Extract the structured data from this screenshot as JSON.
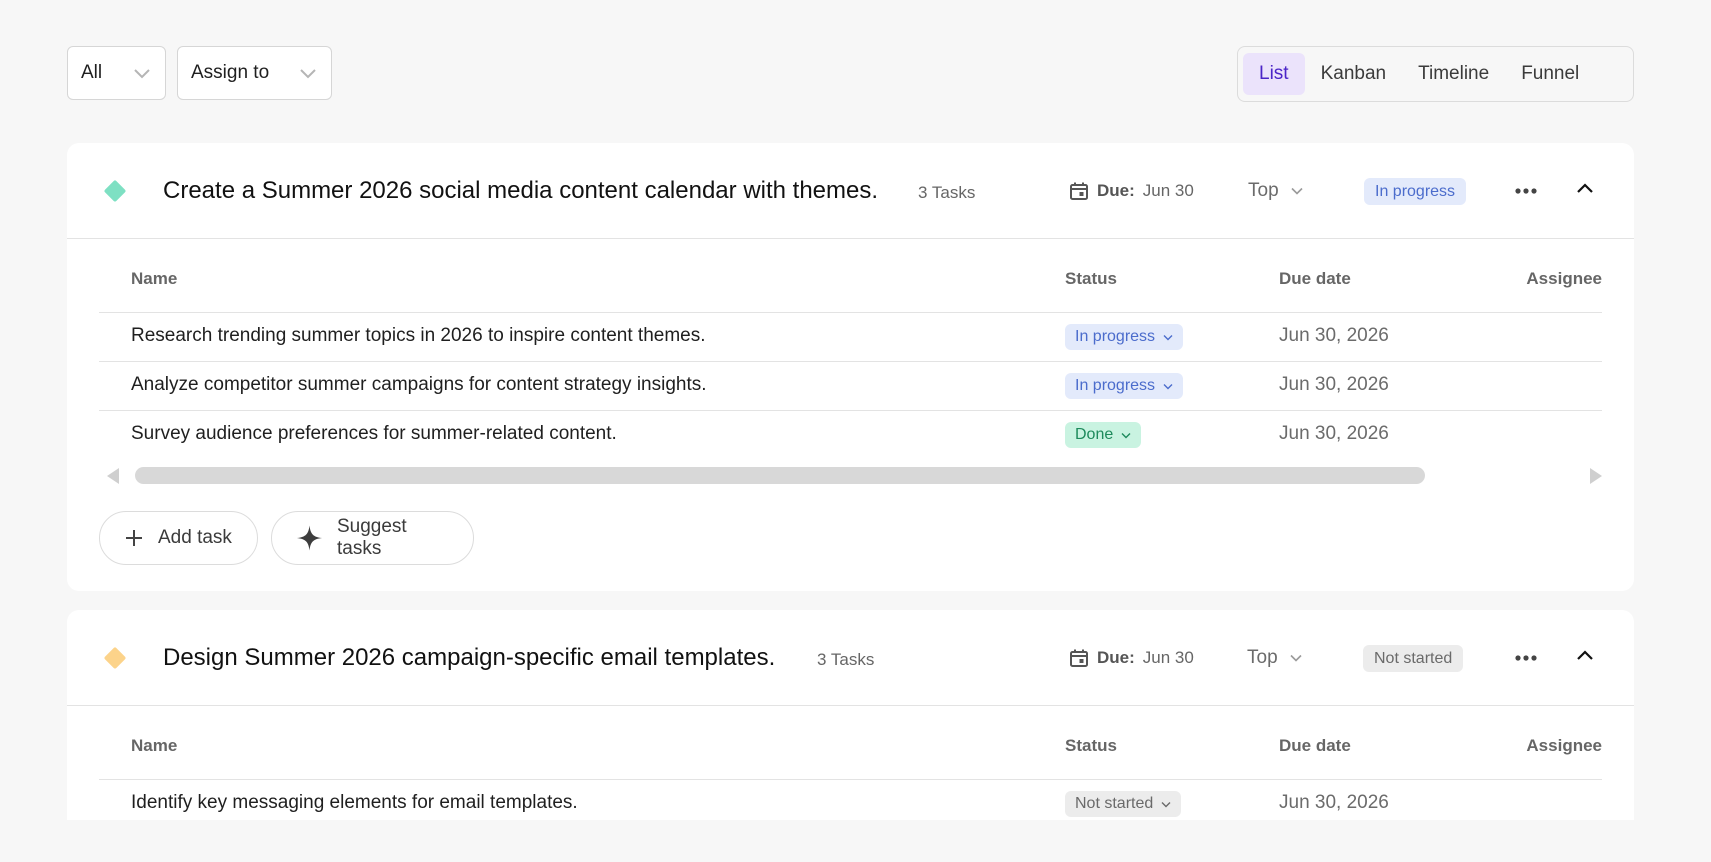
{
  "filters": {
    "status_dropdown": "All",
    "assign_dropdown": "Assign to"
  },
  "views": {
    "tabs": [
      {
        "label": "List",
        "active": true
      },
      {
        "label": "Kanban",
        "active": false
      },
      {
        "label": "Timeline",
        "active": false
      },
      {
        "label": "Funnel",
        "active": false
      }
    ]
  },
  "table_headers": {
    "name": "Name",
    "status": "Status",
    "due_date": "Due date",
    "assignee": "Assignee"
  },
  "projects": [
    {
      "title": "Create a Summer 2026 social media content calendar with themes.",
      "task_count": "3 Tasks",
      "due_label": "Due:",
      "due_value": "Jun 30",
      "priority": "Top",
      "status": "In progress",
      "diamond_color": "#7ee0c3",
      "tasks": [
        {
          "name": "Research trending summer topics in 2026 to inspire content themes.",
          "status": "In progress",
          "due": "Jun 30, 2026"
        },
        {
          "name": "Analyze competitor summer campaigns for content strategy insights.",
          "status": "In progress",
          "due": "Jun 30, 2026"
        },
        {
          "name": "Survey audience preferences for summer-related content.",
          "status": "Done",
          "due": "Jun 30, 2026"
        }
      ],
      "actions": {
        "add_task": "Add task",
        "suggest_tasks": "Suggest tasks"
      }
    },
    {
      "title": "Design Summer 2026 campaign-specific email templates.",
      "task_count": "3 Tasks",
      "due_label": "Due:",
      "due_value": "Jun 30",
      "priority": "Top",
      "status": "Not started",
      "diamond_color": "#fcd38a",
      "tasks": [
        {
          "name": "Identify key messaging elements for email templates.",
          "status": "Not started",
          "due": "Jun 30, 2026"
        }
      ]
    }
  ],
  "icons": {
    "chevron_down": "chevron-down-icon",
    "calendar": "calendar-icon",
    "more": "more-horizontal-icon",
    "collapse": "chevron-up-icon",
    "plus": "plus-icon",
    "sparkle": "sparkle-icon"
  }
}
